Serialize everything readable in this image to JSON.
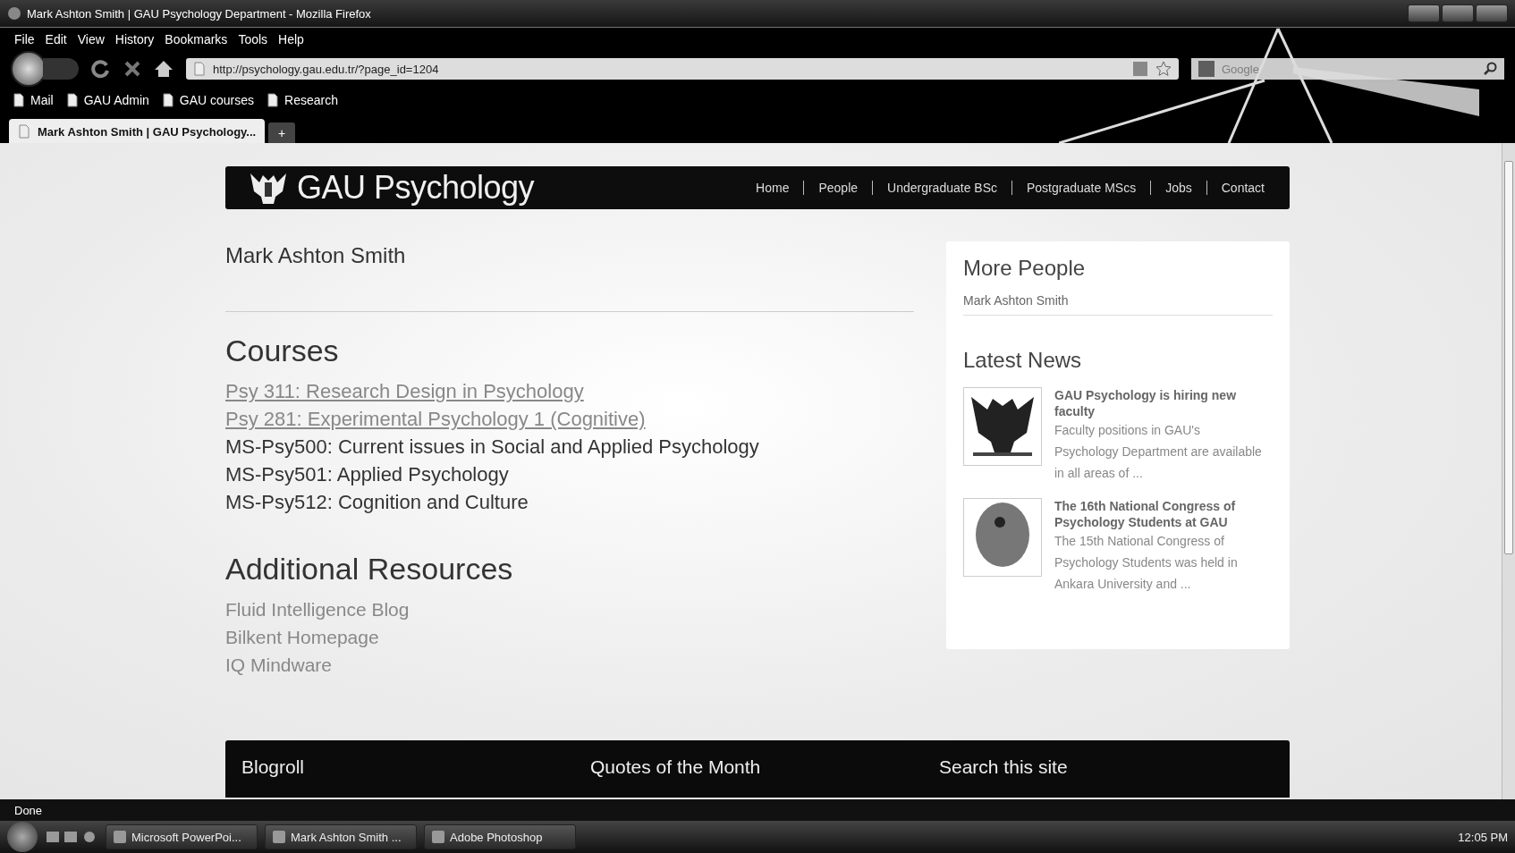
{
  "window": {
    "title": "Mark Ashton Smith | GAU Psychology Department - Mozilla Firefox"
  },
  "menu": [
    "File",
    "Edit",
    "View",
    "History",
    "Bookmarks",
    "Tools",
    "Help"
  ],
  "toolbar": {
    "url": "http://psychology.gau.edu.tr/?page_id=1204",
    "search_placeholder": "Google"
  },
  "bookmarks": [
    "Mail",
    "GAU Admin",
    "GAU courses",
    "Research"
  ],
  "tabs": [
    {
      "label": "Mark Ashton Smith | GAU Psychology...",
      "selected": true
    }
  ],
  "new_tab": "+",
  "site": {
    "logo_text": "GAU Psychology",
    "nav": [
      "Home",
      "People",
      "Undergraduate BSc",
      "Postgraduate MScs",
      "Jobs",
      "Contact"
    ]
  },
  "page_title": "Mark Ashton Smith",
  "courses": {
    "heading": "Courses",
    "items": [
      {
        "label": "Psy 311: Research Design in Psychology",
        "kind": "link"
      },
      {
        "label": "Psy 281: Experimental Psychology 1 (Cognitive)",
        "kind": "link"
      },
      {
        "label": "MS-Psy500: Current issues in Social and Applied Psychology",
        "kind": "plain"
      },
      {
        "label": "MS-Psy501: Applied Psychology",
        "kind": "plain"
      },
      {
        "label": "MS-Psy512: Cognition and Culture",
        "kind": "plain"
      }
    ]
  },
  "resources": {
    "heading": "Additional Resources",
    "items": [
      "Fluid Intelligence Blog",
      "Bilkent Homepage",
      "IQ Mindware"
    ]
  },
  "sidebar": {
    "more_people": {
      "title": "More People",
      "items": [
        "Mark Ashton Smith"
      ]
    },
    "latest_news": {
      "title": "Latest News",
      "items": [
        {
          "title": "GAU Psychology is hiring new faculty",
          "excerpt": "Faculty positions in GAU's Psychology Department are available in all areas of ...",
          "kind": "emblem"
        },
        {
          "title": "The 16th National Congress of Psychology Students at GAU",
          "excerpt": "The 15th National Congress of Psychology Students was held in Ankara University and ...",
          "kind": "head"
        }
      ]
    }
  },
  "footer": [
    "Blogroll",
    "Quotes of the Month",
    "Search this site"
  ],
  "status_bar": "Done",
  "taskbar": {
    "items": [
      "Microsoft PowerPoi...",
      "Mark Ashton Smith ...",
      "Adobe Photoshop"
    ],
    "clock": "12:05 PM"
  }
}
